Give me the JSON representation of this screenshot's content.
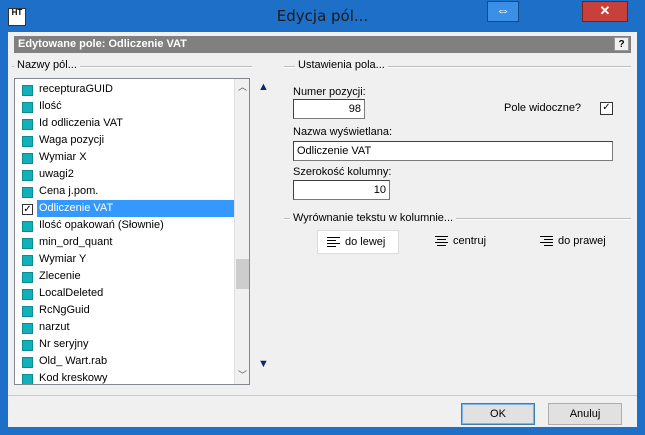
{
  "window": {
    "title": "Edycja pól...",
    "app_icon": "HT",
    "resize_glyph": "⇔",
    "close_glyph": "✕"
  },
  "header": {
    "title": "Edytowane pole: Odliczenie VAT",
    "help": "?"
  },
  "fields_group": {
    "label": "Nazwy pól...",
    "items": [
      {
        "label": "recepturaGUID",
        "checked": false
      },
      {
        "label": "Ilość",
        "checked": false
      },
      {
        "label": "Id odliczenia VAT",
        "checked": false
      },
      {
        "label": "Waga pozycji",
        "checked": false
      },
      {
        "label": "Wymiar X",
        "checked": false
      },
      {
        "label": "uwagi2",
        "checked": false
      },
      {
        "label": "Cena j.pom.",
        "checked": false
      },
      {
        "label": "Odliczenie VAT",
        "checked": true,
        "selected": true
      },
      {
        "label": "Ilość opakowań (Słownie)",
        "checked": false
      },
      {
        "label": "min_ord_quant",
        "checked": false
      },
      {
        "label": "Wymiar Y",
        "checked": false
      },
      {
        "label": "Zlecenie",
        "checked": false
      },
      {
        "label": "LocalDeleted",
        "checked": false
      },
      {
        "label": "RcNgGuid",
        "checked": false
      },
      {
        "label": "narzut",
        "checked": false
      },
      {
        "label": "Nr seryjny",
        "checked": false
      },
      {
        "label": "Old_ Wart.rab",
        "checked": false
      },
      {
        "label": "Kod kreskowy",
        "checked": false
      }
    ]
  },
  "settings_group": {
    "label": "Ustawienia pola...",
    "position_label": "Numer pozycji:",
    "position_value": "98",
    "visible_label": "Pole widoczne?",
    "visible_checked": true,
    "display_name_label": "Nazwa wyświetlana:",
    "display_name_value": "Odliczenie VAT",
    "width_label": "Szerokość kolumny:",
    "width_value": "10"
  },
  "alignment_group": {
    "label": "Wyrównanie tekstu w kolumnie...",
    "left": "do lewej",
    "center": "centruj",
    "right": "do prawej",
    "active": "left"
  },
  "buttons": {
    "ok": "OK",
    "cancel": "Anuluj"
  }
}
